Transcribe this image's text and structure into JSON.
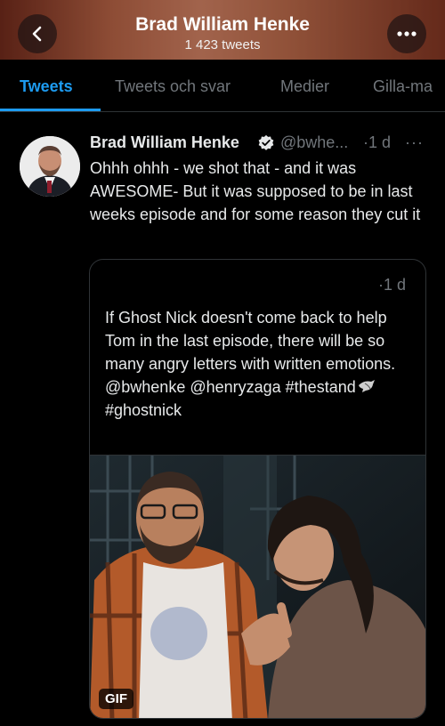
{
  "header": {
    "title": "Brad William Henke",
    "subtitle": "1 423 tweets",
    "back_icon": "chevron-left-icon",
    "more_icon": "more-horizontal-icon"
  },
  "tabs": [
    {
      "label": "Tweets",
      "active": true
    },
    {
      "label": "Tweets och svar",
      "active": false
    },
    {
      "label": "Medier",
      "active": false
    },
    {
      "label": "Gilla-ma",
      "active": false
    }
  ],
  "tweet": {
    "author_name": "Brad William Henke",
    "verified": true,
    "handle": "@bwhe...",
    "time": "·1 d",
    "more": "···",
    "text": "Ohhh ohhh - we shot that - and it was AWESOME- But it was supposed to be in last weeks episode and for some reason they cut it",
    "quote": {
      "time": "·1 d",
      "text_line1": "If Ghost Nick doesn't come back to help Tom in the last episode, there will be so many angry letters with written emotions.",
      "mentions": "@bwhenke @henryzaga #thestand",
      "hashtag2": "#ghostnick",
      "media_badge": "GIF"
    }
  },
  "colors": {
    "accent": "#1d9bf0",
    "background": "#000000",
    "text": "#e7e9ea",
    "muted": "#71767b",
    "border": "#2f3336"
  }
}
